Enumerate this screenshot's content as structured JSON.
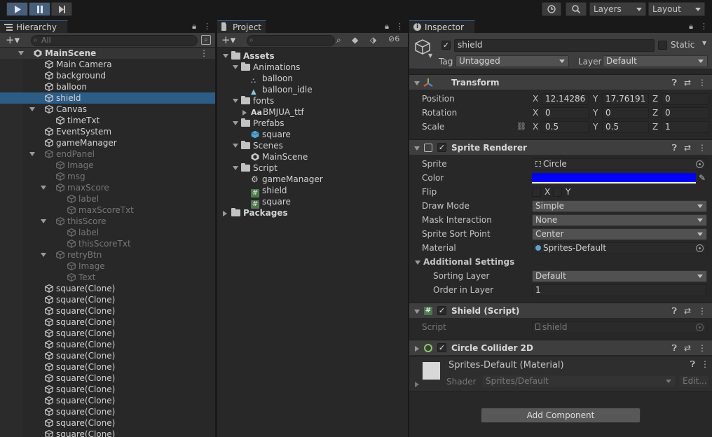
{
  "toolbar": {
    "layers_label": "Layers",
    "layout_label": "Layout"
  },
  "hierarchy": {
    "tab_label": "Hierarchy",
    "search_placeholder": "All",
    "items": [
      {
        "label": "MainScene",
        "depth": 0,
        "kind": "scene",
        "fold": "open"
      },
      {
        "label": "Main Camera",
        "depth": 1,
        "kind": "go"
      },
      {
        "label": "background",
        "depth": 1,
        "kind": "go"
      },
      {
        "label": "balloon",
        "depth": 1,
        "kind": "go"
      },
      {
        "label": "shield",
        "depth": 1,
        "kind": "go",
        "selected": true
      },
      {
        "label": "Canvas",
        "depth": 1,
        "kind": "go",
        "fold": "open"
      },
      {
        "label": "timeTxt",
        "depth": 2,
        "kind": "go"
      },
      {
        "label": "EventSystem",
        "depth": 1,
        "kind": "go"
      },
      {
        "label": "gameManager",
        "depth": 1,
        "kind": "go"
      },
      {
        "label": "endPanel",
        "depth": 1,
        "kind": "go",
        "fold": "open",
        "dim": true
      },
      {
        "label": "Image",
        "depth": 2,
        "kind": "go",
        "dim": true
      },
      {
        "label": "msg",
        "depth": 2,
        "kind": "go",
        "dim": true
      },
      {
        "label": "maxScore",
        "depth": 2,
        "kind": "go",
        "fold": "open",
        "dim": true
      },
      {
        "label": "label",
        "depth": 3,
        "kind": "go",
        "dim": true
      },
      {
        "label": "maxScoreTxt",
        "depth": 3,
        "kind": "go",
        "dim": true
      },
      {
        "label": "thisScore",
        "depth": 2,
        "kind": "go",
        "fold": "open",
        "dim": true
      },
      {
        "label": "label",
        "depth": 3,
        "kind": "go",
        "dim": true
      },
      {
        "label": "thisScoreTxt",
        "depth": 3,
        "kind": "go",
        "dim": true
      },
      {
        "label": "retryBtn",
        "depth": 2,
        "kind": "go",
        "fold": "open",
        "dim": true
      },
      {
        "label": "Image",
        "depth": 3,
        "kind": "go",
        "dim": true
      },
      {
        "label": "Text",
        "depth": 3,
        "kind": "go",
        "dim": true
      },
      {
        "label": "square(Clone)",
        "depth": 1,
        "kind": "go"
      },
      {
        "label": "square(Clone)",
        "depth": 1,
        "kind": "go"
      },
      {
        "label": "square(Clone)",
        "depth": 1,
        "kind": "go"
      },
      {
        "label": "square(Clone)",
        "depth": 1,
        "kind": "go"
      },
      {
        "label": "square(Clone)",
        "depth": 1,
        "kind": "go"
      },
      {
        "label": "square(Clone)",
        "depth": 1,
        "kind": "go"
      },
      {
        "label": "square(Clone)",
        "depth": 1,
        "kind": "go"
      },
      {
        "label": "square(Clone)",
        "depth": 1,
        "kind": "go"
      },
      {
        "label": "square(Clone)",
        "depth": 1,
        "kind": "go"
      },
      {
        "label": "square(Clone)",
        "depth": 1,
        "kind": "go"
      },
      {
        "label": "square(Clone)",
        "depth": 1,
        "kind": "go"
      },
      {
        "label": "square(Clone)",
        "depth": 1,
        "kind": "go"
      },
      {
        "label": "square(Clone)",
        "depth": 1,
        "kind": "go"
      },
      {
        "label": "square(Clone)",
        "depth": 1,
        "kind": "go"
      }
    ]
  },
  "project": {
    "tab_label": "Project",
    "hidden_count": "6",
    "items": [
      {
        "label": "Assets",
        "depth": 0,
        "kind": "folder",
        "fold": "open",
        "bold": true
      },
      {
        "label": "Animations",
        "depth": 1,
        "kind": "folder",
        "fold": "open"
      },
      {
        "label": "balloon",
        "depth": 2,
        "kind": "anim"
      },
      {
        "label": "balloon_idle",
        "depth": 2,
        "kind": "clip"
      },
      {
        "label": "fonts",
        "depth": 1,
        "kind": "folder",
        "fold": "open"
      },
      {
        "label": "BMJUA_ttf",
        "depth": 2,
        "kind": "font",
        "fold": "closed",
        "icon_text": "Aa"
      },
      {
        "label": "Prefabs",
        "depth": 1,
        "kind": "folder",
        "fold": "open"
      },
      {
        "label": "square",
        "depth": 2,
        "kind": "prefab"
      },
      {
        "label": "Scenes",
        "depth": 1,
        "kind": "folder",
        "fold": "open"
      },
      {
        "label": "MainScene",
        "depth": 2,
        "kind": "scene"
      },
      {
        "label": "Script",
        "depth": 1,
        "kind": "folder",
        "fold": "open"
      },
      {
        "label": "gameManager",
        "depth": 2,
        "kind": "gear"
      },
      {
        "label": "shield",
        "depth": 2,
        "kind": "script"
      },
      {
        "label": "square",
        "depth": 2,
        "kind": "script"
      },
      {
        "label": "Packages",
        "depth": 0,
        "kind": "folder",
        "fold": "closed",
        "bold": true
      }
    ]
  },
  "inspector": {
    "tab_label": "Inspector",
    "object_name": "shield",
    "static_label": "Static",
    "tag_label": "Tag",
    "tag_value": "Untagged",
    "layer_label": "Layer",
    "layer_value": "Default",
    "transform": {
      "title": "Transform",
      "position_label": "Position",
      "rotation_label": "Rotation",
      "scale_label": "Scale",
      "axis_x": "X",
      "axis_y": "Y",
      "axis_z": "Z",
      "position": {
        "x": "12.14286",
        "y": "17.76191",
        "z": "0"
      },
      "rotation": {
        "x": "0",
        "y": "0",
        "z": "0"
      },
      "scale": {
        "x": "0.5",
        "y": "0.5",
        "z": "1"
      }
    },
    "sprite_renderer": {
      "title": "Sprite Renderer",
      "sprite_label": "Sprite",
      "sprite_value": "Circle",
      "color_label": "Color",
      "color_value": "#0000ff",
      "flip_label": "Flip",
      "flip_x": "X",
      "flip_y": "Y",
      "draw_mode_label": "Draw Mode",
      "draw_mode_value": "Simple",
      "mask_label": "Mask Interaction",
      "mask_value": "None",
      "sort_point_label": "Sprite Sort Point",
      "sort_point_value": "Center",
      "material_label": "Material",
      "material_value": "Sprites-Default",
      "additional_label": "Additional Settings",
      "sorting_layer_label": "Sorting Layer",
      "sorting_layer_value": "Default",
      "order_label": "Order in Layer",
      "order_value": "1"
    },
    "shield_script": {
      "title": "Shield (Script)",
      "script_label": "Script",
      "script_value": "shield"
    },
    "circle_collider": {
      "title": "Circle Collider 2D"
    },
    "material": {
      "title": "Sprites-Default (Material)",
      "shader_label": "Shader",
      "shader_value": "Sprites/Default",
      "edit_label": "Edit..."
    },
    "add_component_label": "Add Component"
  },
  "colors": {
    "selection": "#2c5d87",
    "accent_tab": "#2e5e90",
    "color_swatch": "#0000ff"
  }
}
